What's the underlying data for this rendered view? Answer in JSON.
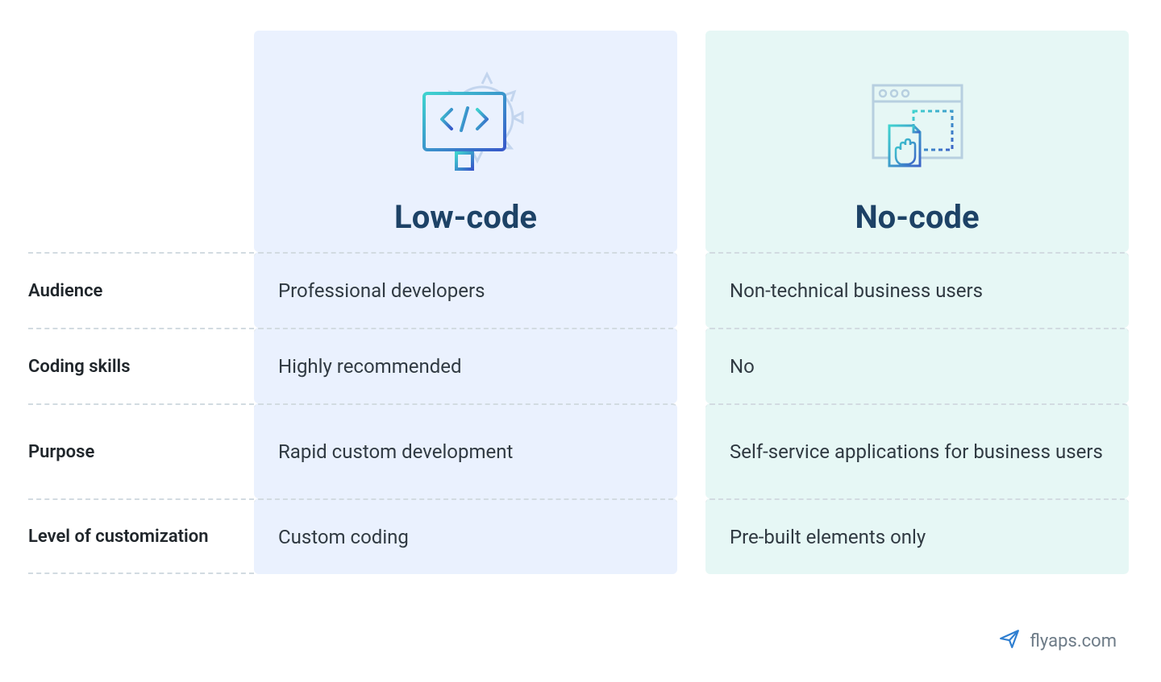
{
  "columns": {
    "lowcode": {
      "title": "Low-code"
    },
    "nocode": {
      "title": "No-code"
    }
  },
  "rows": [
    {
      "label": "Audience",
      "lowcode": "Professional developers",
      "nocode": "Non-technical business users"
    },
    {
      "label": "Coding skills",
      "lowcode": "Highly recommended",
      "nocode": "No"
    },
    {
      "label": "Purpose",
      "lowcode": "Rapid custom development",
      "nocode": "Self-service applications for business users"
    },
    {
      "label": "Level of customization",
      "lowcode": "Custom coding",
      "nocode": "Pre-built elements only"
    }
  ],
  "footer": {
    "site": "flyaps.com"
  }
}
